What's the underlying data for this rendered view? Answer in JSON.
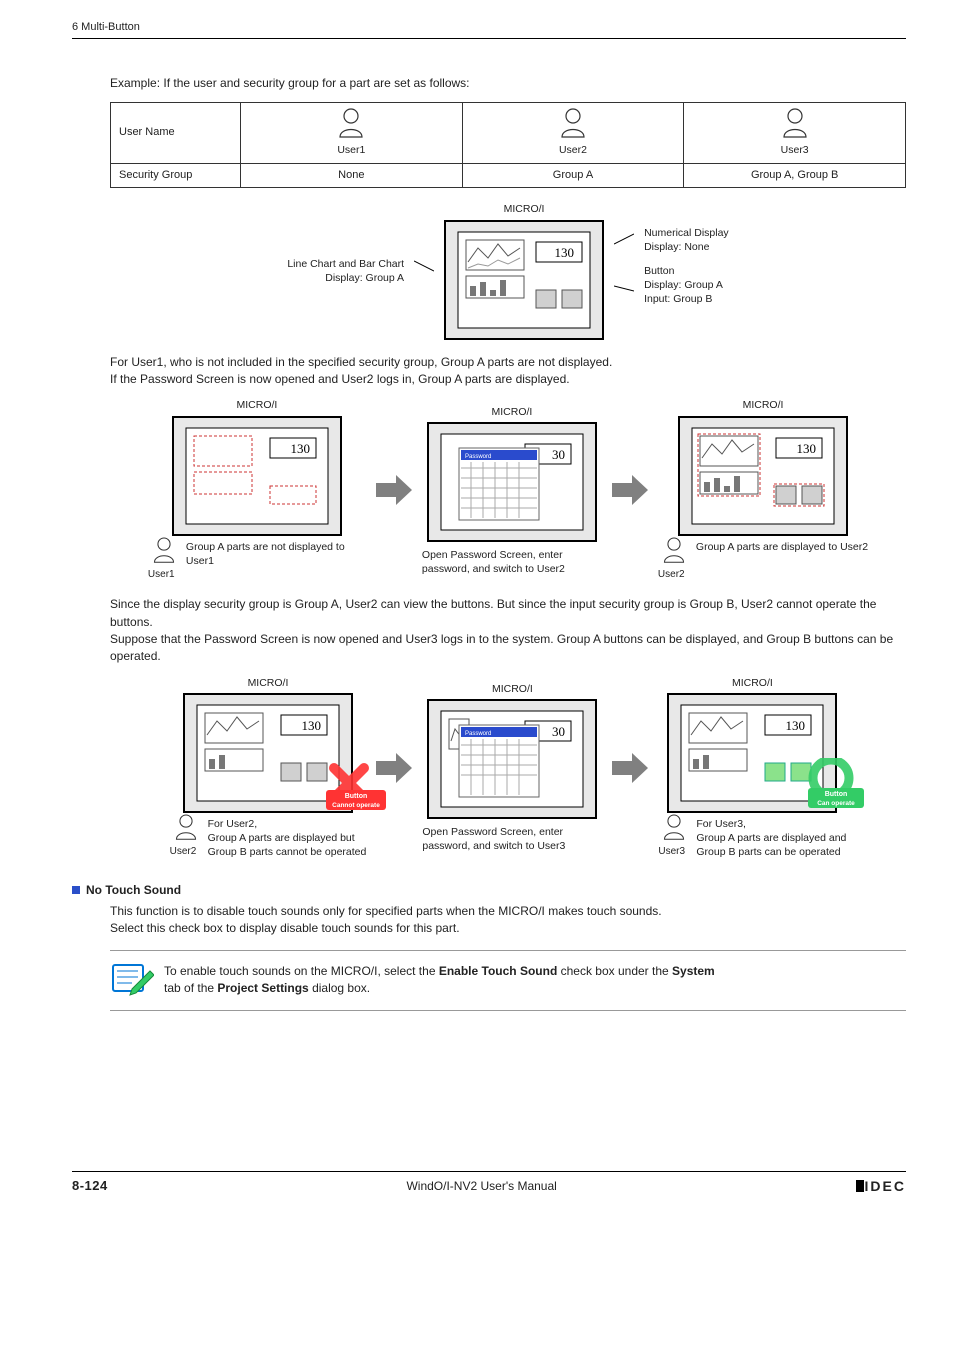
{
  "running_head": "6 Multi-Button",
  "intro": "Example: If the user and security group for a part are set as follows:",
  "table": {
    "row1": "User Name",
    "row2": "Security Group",
    "users": [
      {
        "name": "User1",
        "group": "None"
      },
      {
        "name": "User2",
        "group": "Group A"
      },
      {
        "name": "User3",
        "group": "Group A, Group B"
      }
    ]
  },
  "main_fig": {
    "title": "MICRO/I",
    "left_callout": "Line Chart and Bar Chart\nDisplay: Group A",
    "right_callout_1": "Numerical Display\nDisplay: None",
    "right_callout_2": "Button\nDisplay: Group A\nInput: Group B",
    "value": "130"
  },
  "para1": "For User1, who is not included in the specified security group, Group A parts are not displayed.\nIf the Password Screen is now opened and User2 logs in, Group A parts are displayed.",
  "flow1": {
    "title": "MICRO/I",
    "panel1_value": "130",
    "panel2_value": "30",
    "panel3_value": "130",
    "cap1_user": "User1",
    "cap1": "Group A parts are not displayed to User1",
    "cap2": "Open Password Screen, enter password, and switch to User2",
    "cap3_user": "User2",
    "cap3": "Group A parts are displayed to User2",
    "pwd_label": "Password"
  },
  "para2": "Since the display security group is Group A, User2 can view the buttons. But since the input security group is Group B, User2 cannot operate the buttons.\nSuppose that the Password Screen is now opened and User3 logs in to the system. Group A buttons can be displayed, and Group B buttons can be operated.",
  "flow2": {
    "title": "MICRO/I",
    "panel1_value": "130",
    "panel2_value": "30",
    "panel3_value": "130",
    "cap1_user": "User2",
    "cap1": "For User2,\nGroup A parts are displayed but\nGroup B parts cannot be operated",
    "cap2": "Open Password Screen, enter password, and switch to User3",
    "cap3_user": "User3",
    "cap3": "For User3,\nGroup A parts are displayed and\nGroup B parts can be operated",
    "badge1_line1": "Button",
    "badge1_line2": "Cannot operate",
    "badge2_line1": "Button",
    "badge2_line2": "Can operate",
    "pwd_label": "Password"
  },
  "section": {
    "heading": "No Touch Sound",
    "body1": "This function is to disable touch sounds only for specified parts when the MICRO/I makes touch sounds.",
    "body2": "Select this check box to display disable touch sounds for this part."
  },
  "note": {
    "text_before": "To enable touch sounds on the MICRO/I, select the ",
    "bold1": "Enable Touch Sound",
    "mid": " check box under the ",
    "bold2": "System",
    "after_newline": "tab of the ",
    "bold3": "Project Settings",
    "tail": " dialog box."
  },
  "footer": {
    "page": "8-124",
    "manual": "WindO/I-NV2 User's Manual",
    "brand": "IDEC"
  }
}
